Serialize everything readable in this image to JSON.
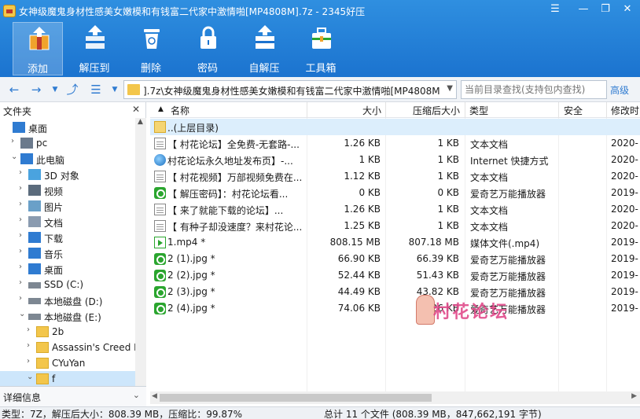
{
  "window": {
    "title": "女神级魔鬼身材性感美女嫩模和有钱富二代家中激情啪[MP4808M].7z - 2345好压",
    "controls": [
      "☰",
      "—",
      "❐",
      "✕"
    ]
  },
  "toolbar": [
    {
      "id": "add",
      "label": "添加",
      "icon": "add-icon",
      "active": true
    },
    {
      "id": "extract",
      "label": "解压到",
      "icon": "extract-icon",
      "active": false
    },
    {
      "id": "delete",
      "label": "删除",
      "icon": "trash-icon",
      "active": false
    },
    {
      "id": "password",
      "label": "密码",
      "icon": "lock-icon",
      "active": false
    },
    {
      "id": "sfx",
      "label": "自解压",
      "icon": "self-extract-icon",
      "active": false
    },
    {
      "id": "tools",
      "label": "工具箱",
      "icon": "toolbox-icon",
      "active": false
    }
  ],
  "nav": {
    "path": "].7z\\女神级魔鬼身材性感美女嫩模和有钱富二代家中激情啪[MP4808M]",
    "search_placeholder": "当前目录查找(支持包内查找)",
    "advanced_label": "高级"
  },
  "left_pane": {
    "header": "文件夹",
    "close": "✕",
    "tree": [
      {
        "label": "桌面",
        "icon": "desktop-icon",
        "indent": 0,
        "arrow": ""
      },
      {
        "label": "pc",
        "icon": "user-icon",
        "indent": 1,
        "arrow": "›"
      },
      {
        "label": "此电脑",
        "icon": "computer-icon",
        "indent": 1,
        "arrow": "⌄"
      },
      {
        "label": "3D 对象",
        "icon": "3d-objects-icon",
        "indent": 2,
        "arrow": "›"
      },
      {
        "label": "视频",
        "icon": "video-folder-icon",
        "indent": 2,
        "arrow": "›"
      },
      {
        "label": "图片",
        "icon": "pictures-folder-icon",
        "indent": 2,
        "arrow": "›"
      },
      {
        "label": "文档",
        "icon": "documents-folder-icon",
        "indent": 2,
        "arrow": "›"
      },
      {
        "label": "下载",
        "icon": "downloads-folder-icon",
        "indent": 2,
        "arrow": "›"
      },
      {
        "label": "音乐",
        "icon": "music-folder-icon",
        "indent": 2,
        "arrow": "›"
      },
      {
        "label": "桌面",
        "icon": "desktop-icon",
        "indent": 2,
        "arrow": "›"
      },
      {
        "label": "SSD (C:)",
        "icon": "drive-icon",
        "indent": 2,
        "arrow": "›"
      },
      {
        "label": "本地磁盘 (D:)",
        "icon": "drive-icon",
        "indent": 2,
        "arrow": "›"
      },
      {
        "label": "本地磁盘 (E:)",
        "icon": "drive-icon",
        "indent": 2,
        "arrow": "⌄"
      },
      {
        "label": "2b",
        "icon": "folder-icon",
        "indent": 3,
        "arrow": "›"
      },
      {
        "label": "Assassin's Creed IV",
        "icon": "folder-icon",
        "indent": 3,
        "arrow": "›"
      },
      {
        "label": "CYuYan",
        "icon": "folder-icon",
        "indent": 3,
        "arrow": "›"
      },
      {
        "label": "f",
        "icon": "folder-icon",
        "indent": 3,
        "arrow": "⌄",
        "selected": true
      }
    ],
    "details_label": "详细信息",
    "details_toggle": "⌄"
  },
  "columns": {
    "name": "名称",
    "size": "大小",
    "compressed": "压缩后大小",
    "type": "类型",
    "security": "安全",
    "modified": "修改时"
  },
  "files": [
    {
      "name": "..(上层目录)",
      "size": "",
      "compressed": "",
      "type": "",
      "modified": "",
      "icon": "folder-up"
    },
    {
      "name": "【 村花论坛】全免费-无套路-...",
      "size": "1.26 KB",
      "compressed": "1 KB",
      "type": "文本文档",
      "modified": "2020-",
      "icon": "text"
    },
    {
      "name": "村花论坛永久地址发布页】-...",
      "size": "1 KB",
      "compressed": "1 KB",
      "type": "Internet 快捷方式",
      "modified": "2020-",
      "icon": "globe"
    },
    {
      "name": "【 村花视频】万部视频免费在...",
      "size": "1.12 KB",
      "compressed": "1 KB",
      "type": "文本文档",
      "modified": "2020-",
      "icon": "text"
    },
    {
      "name": "【 解压密码】：村花论坛看...",
      "size": "0 KB",
      "compressed": "0 KB",
      "type": "爱奇艺万能播放器",
      "modified": "2019-",
      "icon": "iqiyi"
    },
    {
      "name": "【 来了就能下载的论坛】...",
      "size": "1.26 KB",
      "compressed": "1 KB",
      "type": "文本文档",
      "modified": "2020-",
      "icon": "text"
    },
    {
      "name": "【 有种子却没速度？来村花论...",
      "size": "1.25 KB",
      "compressed": "1 KB",
      "type": "文本文档",
      "modified": "2020-",
      "icon": "text"
    },
    {
      "name": "1.mp4 *",
      "size": "808.15 MB",
      "compressed": "807.18 MB",
      "type": "媒体文件(.mp4)",
      "modified": "2019-",
      "icon": "media"
    },
    {
      "name": "2 (1).jpg *",
      "size": "66.90 KB",
      "compressed": "66.39 KB",
      "type": "爱奇艺万能播放器",
      "modified": "2019-",
      "icon": "iqiyi"
    },
    {
      "name": "2 (2).jpg *",
      "size": "52.44 KB",
      "compressed": "51.43 KB",
      "type": "爱奇艺万能播放器",
      "modified": "2019-",
      "icon": "iqiyi"
    },
    {
      "name": "2 (3).jpg *",
      "size": "44.49 KB",
      "compressed": "43.82 KB",
      "type": "爱奇艺万能播放器",
      "modified": "2019-",
      "icon": "iqiyi"
    },
    {
      "name": "2 (4).jpg *",
      "size": "74.06 KB",
      "compressed": "73.26 KB",
      "type": "爱奇艺万能播放器",
      "modified": "2019-",
      "icon": "iqiyi"
    }
  ],
  "watermark": "村花论坛",
  "status": {
    "left": "类型：7Z，解压后大小：808.39 MB，压缩比：99.87%",
    "right": "总计 11 个文件 (808.39 MB，847,662,191 字节)"
  },
  "colors": {
    "titlebar": "#2f8fe0",
    "selection": "#cde6fb",
    "accent": "#2f7bd1"
  }
}
